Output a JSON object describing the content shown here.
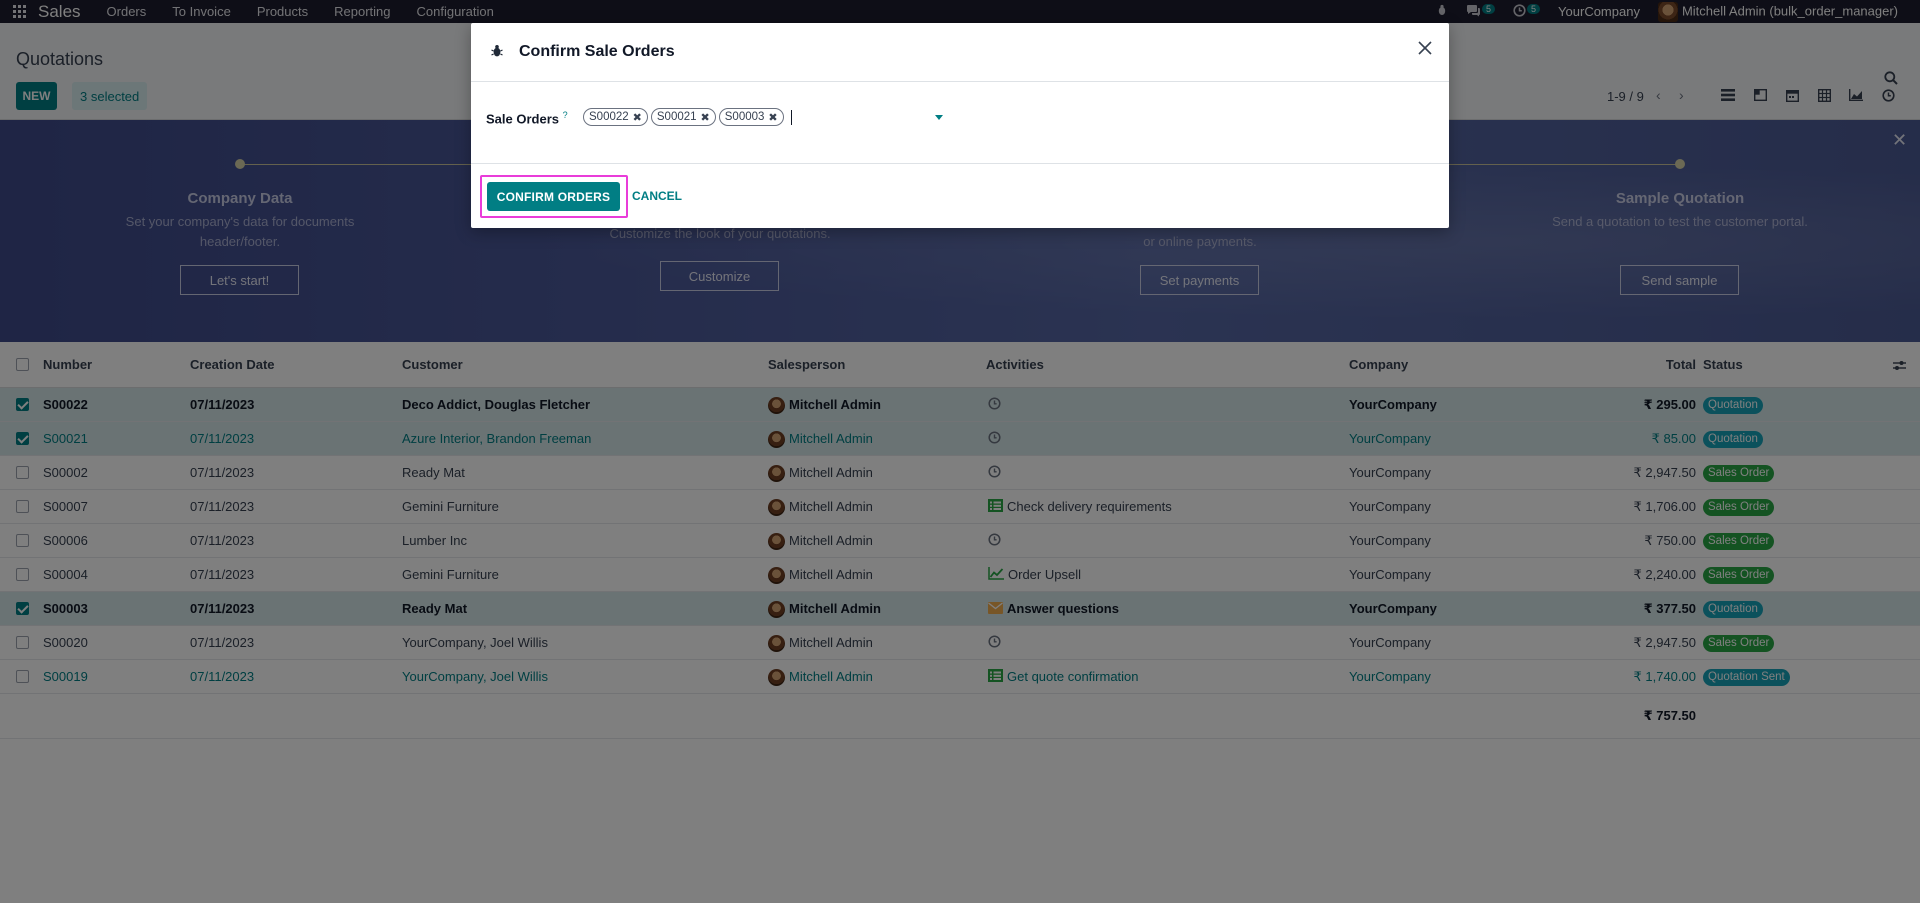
{
  "navbar": {
    "brand": "Sales",
    "menu": [
      "Orders",
      "To Invoice",
      "Products",
      "Reporting",
      "Configuration"
    ],
    "messages_count": "5",
    "activities_count": "5",
    "company": "YourCompany",
    "user": "Mitchell Admin (bulk_order_manager)"
  },
  "control_panel": {
    "title": "Quotations",
    "new_label": "NEW",
    "selected_label": "3 selected",
    "pager": "1-9 / 9"
  },
  "onboarding": {
    "steps": [
      {
        "title": "Company Data",
        "desc": "Set your company's data for documents header/footer.",
        "button": "Let's start!"
      },
      {
        "title": "",
        "desc": "Customize the look of your quotations.",
        "button": "Customize"
      },
      {
        "title": "",
        "desc": "or online payments.",
        "button": "Set payments"
      },
      {
        "title": "Sample Quotation",
        "desc": "Send a quotation to test the customer portal.",
        "button": "Send sample"
      }
    ]
  },
  "table": {
    "headers": {
      "number": "Number",
      "date": "Creation Date",
      "customer": "Customer",
      "salesperson": "Salesperson",
      "activities": "Activities",
      "company": "Company",
      "total": "Total",
      "status": "Status"
    },
    "rows": [
      {
        "number": "S00022",
        "date": "07/11/2023",
        "customer": "Deco Addict, Douglas Fletcher",
        "salesperson": "Mitchell Admin",
        "activity": "",
        "activity_icon": "clock-icon",
        "company": "YourCompany",
        "total": "₹ 295.00",
        "status": "Quotation",
        "status_kind": "info",
        "selected": true,
        "style": "bold"
      },
      {
        "number": "S00021",
        "date": "07/11/2023",
        "customer": "Azure Interior, Brandon Freeman",
        "salesperson": "Mitchell Admin",
        "activity": "",
        "activity_icon": "clock-icon",
        "company": "YourCompany",
        "total": "₹ 85.00",
        "status": "Quotation",
        "status_kind": "info",
        "selected": true,
        "style": "link"
      },
      {
        "number": "S00002",
        "date": "07/11/2023",
        "customer": "Ready Mat",
        "salesperson": "Mitchell Admin",
        "activity": "",
        "activity_icon": "clock-icon",
        "company": "YourCompany",
        "total": "₹ 2,947.50",
        "status": "Sales Order",
        "status_kind": "success",
        "selected": false,
        "style": "normal"
      },
      {
        "number": "S00007",
        "date": "07/11/2023",
        "customer": "Gemini Furniture",
        "salesperson": "Mitchell Admin",
        "activity": "Check delivery requirements",
        "activity_icon": "list-icon",
        "company": "YourCompany",
        "total": "₹ 1,706.00",
        "status": "Sales Order",
        "status_kind": "success",
        "selected": false,
        "style": "normal"
      },
      {
        "number": "S00006",
        "date": "07/11/2023",
        "customer": "Lumber Inc",
        "salesperson": "Mitchell Admin",
        "activity": "",
        "activity_icon": "clock-icon",
        "company": "YourCompany",
        "total": "₹ 750.00",
        "status": "Sales Order",
        "status_kind": "success",
        "selected": false,
        "style": "normal"
      },
      {
        "number": "S00004",
        "date": "07/11/2023",
        "customer": "Gemini Furniture",
        "salesperson": "Mitchell Admin",
        "activity": "Order Upsell",
        "activity_icon": "chart-icon",
        "company": "YourCompany",
        "total": "₹ 2,240.00",
        "status": "Sales Order",
        "status_kind": "success",
        "selected": false,
        "style": "normal"
      },
      {
        "number": "S00003",
        "date": "07/11/2023",
        "customer": "Ready Mat",
        "salesperson": "Mitchell Admin",
        "activity": "Answer questions",
        "activity_icon": "envelope-icon",
        "company": "YourCompany",
        "total": "₹ 377.50",
        "status": "Quotation",
        "status_kind": "info",
        "selected": true,
        "style": "bold"
      },
      {
        "number": "S00020",
        "date": "07/11/2023",
        "customer": "YourCompany, Joel Willis",
        "salesperson": "Mitchell Admin",
        "activity": "",
        "activity_icon": "clock-icon",
        "company": "YourCompany",
        "total": "₹ 2,947.50",
        "status": "Sales Order",
        "status_kind": "success",
        "selected": false,
        "style": "normal"
      },
      {
        "number": "S00019",
        "date": "07/11/2023",
        "customer": "YourCompany, Joel Willis",
        "salesperson": "Mitchell Admin",
        "activity": "Get quote confirmation",
        "activity_icon": "list-icon",
        "company": "YourCompany",
        "total": "₹ 1,740.00",
        "status": "Quotation Sent",
        "status_kind": "info",
        "selected": false,
        "style": "link"
      }
    ],
    "footer_total": "₹ 757.50"
  },
  "dialog": {
    "title": "Confirm Sale Orders",
    "field_label": "Sale Orders",
    "field_help": "?",
    "tags": [
      "S00022",
      "S00021",
      "S00003"
    ],
    "confirm_label": "CONFIRM ORDERS",
    "cancel_label": "CANCEL"
  },
  "colors": {
    "primary": "#017e84",
    "navbar": "#1d1d2e",
    "highlight": "#e93cd9"
  }
}
